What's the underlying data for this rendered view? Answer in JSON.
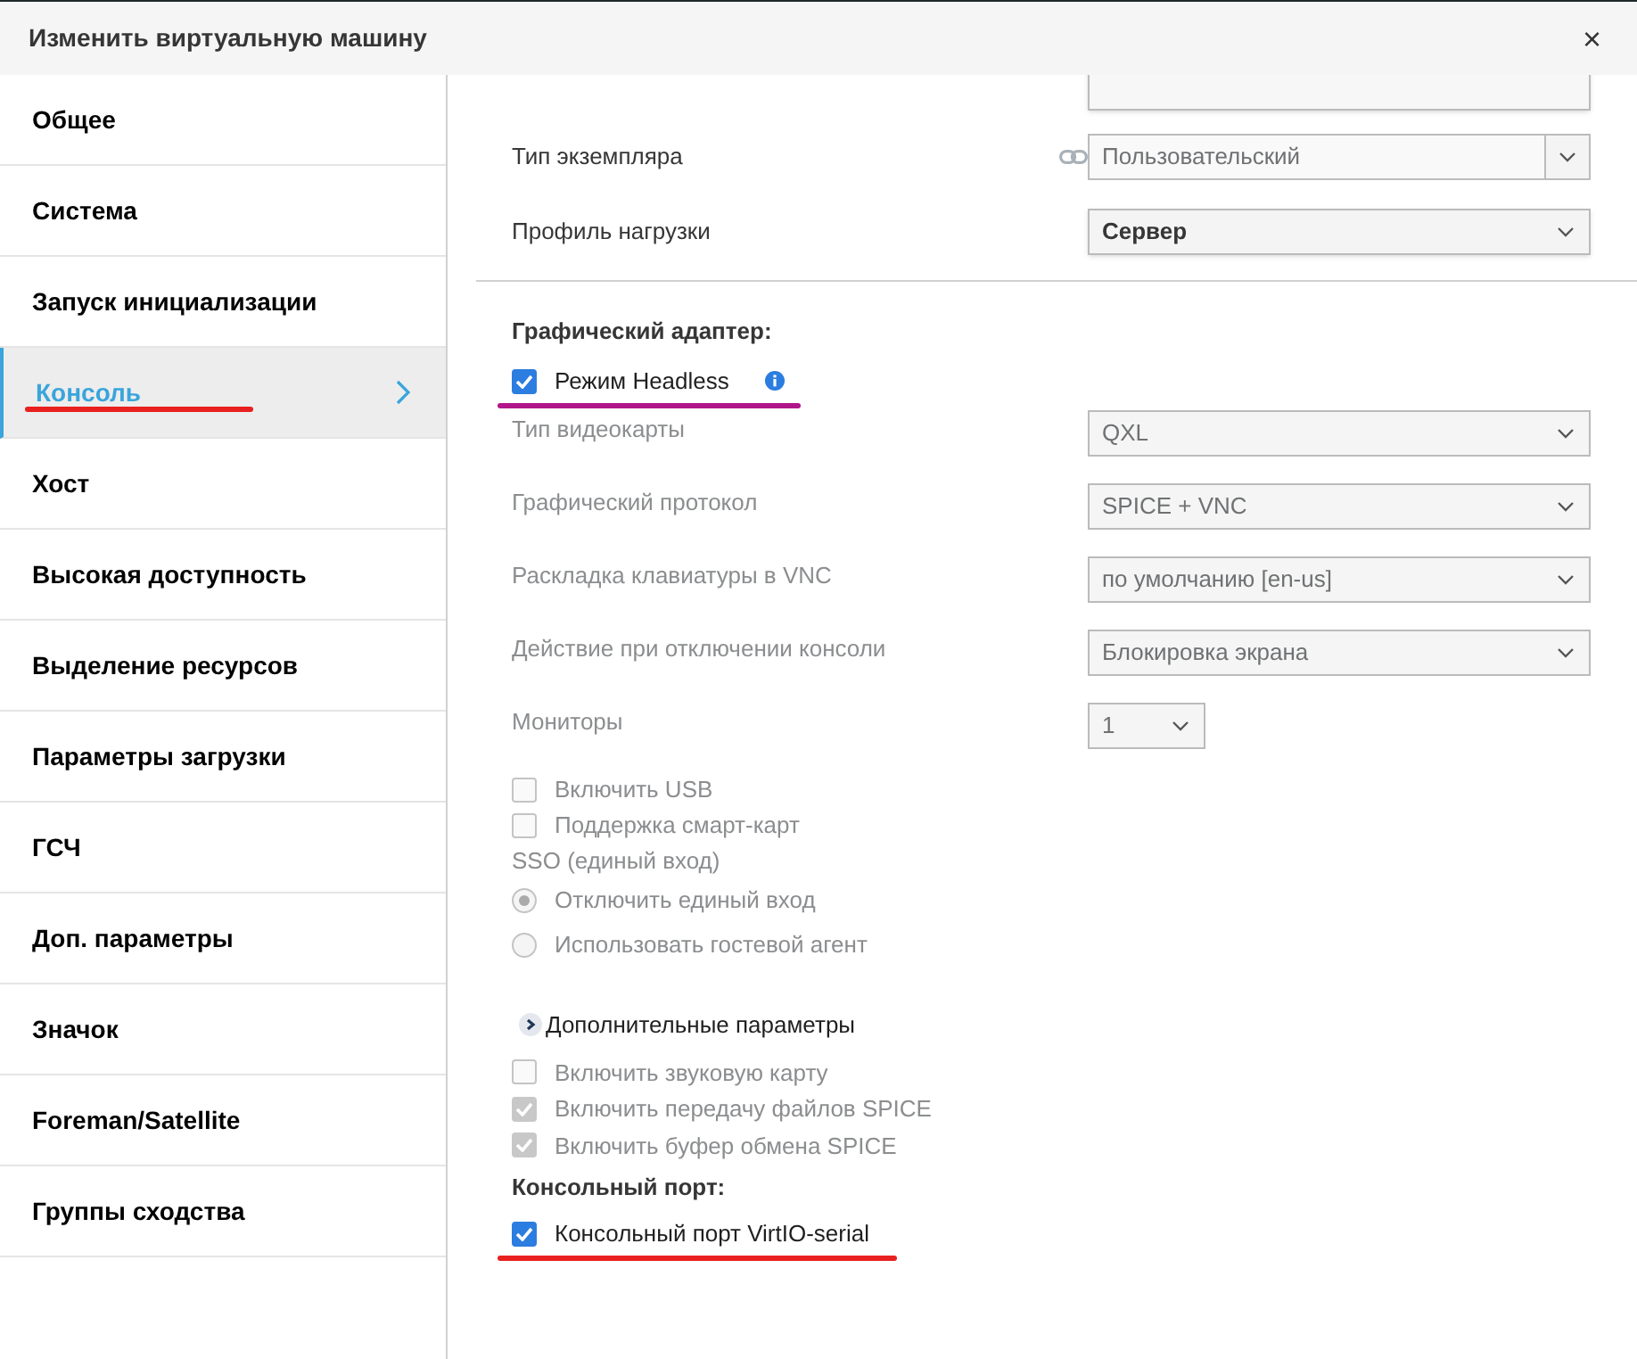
{
  "window": {
    "title": "Изменить виртуальную машину",
    "close": "×"
  },
  "sidebar": {
    "items": [
      {
        "label": "Общее",
        "selected": false
      },
      {
        "label": "Система",
        "selected": false
      },
      {
        "label": "Запуск инициализации",
        "selected": false
      },
      {
        "label": "Консоль",
        "selected": true,
        "underline": {
          "color": "#e8201f"
        }
      },
      {
        "label": "Хост",
        "selected": false
      },
      {
        "label": "Высокая доступность",
        "selected": false
      },
      {
        "label": "Выделение ресурсов",
        "selected": false
      },
      {
        "label": "Параметры загрузки",
        "selected": false
      },
      {
        "label": "ГСЧ",
        "selected": false
      },
      {
        "label": "Доп. параметры",
        "selected": false
      },
      {
        "label": "Значок",
        "selected": false
      },
      {
        "label": "Foreman/Satellite",
        "selected": false
      },
      {
        "label": "Группы сходства",
        "selected": false
      }
    ]
  },
  "general_fields": [
    {
      "kind": "linked",
      "label": "Тип экземпляра",
      "value": "Пользовательский",
      "disabled": true
    },
    {
      "kind": "plain",
      "label": "Профиль нагрузки",
      "value": "Сервер",
      "disabled": false
    }
  ],
  "graphics": {
    "heading": "Графический адаптер:",
    "headless": {
      "label": "Режим Headless",
      "checked": true,
      "underline": {
        "color": "#b0168a"
      }
    },
    "fields": [
      {
        "label": "Тип видеокарты",
        "value": "QXL",
        "disabled": true,
        "narrow": false
      },
      {
        "label": "Графический протокол",
        "value": "SPICE + VNC",
        "disabled": true,
        "narrow": false
      },
      {
        "label": "Раскладка клавиатуры в VNC",
        "value": "по умолчанию [en-us]",
        "disabled": true,
        "narrow": false
      },
      {
        "label": "Действие при отключении консоли",
        "value": "Блокировка экрана",
        "disabled": true,
        "narrow": false
      },
      {
        "label": "Мониторы",
        "value": "1",
        "disabled": true,
        "narrow": true
      }
    ],
    "options": [
      {
        "kind": "checkbox",
        "label": "Включить USB",
        "checked": false,
        "disabled": true
      },
      {
        "kind": "checkbox",
        "label": "Поддержка смарт-карт",
        "checked": false,
        "disabled": true
      },
      {
        "kind": "caption",
        "label": "SSO (единый вход)"
      },
      {
        "kind": "radio",
        "label": "Отключить единый вход",
        "selected": true,
        "disabled": true
      },
      {
        "kind": "radio",
        "label": "Использовать гостевой агент",
        "selected": false,
        "disabled": true
      }
    ],
    "advanced": {
      "label": "Дополнительные параметры",
      "expanded": false
    },
    "advanced_options": [
      {
        "label": "Включить звуковую карту",
        "checked": false,
        "disabled": true
      },
      {
        "label": "Включить передачу файлов SPICE",
        "checked": true,
        "disabled": true
      },
      {
        "label": "Включить буфер обмена SPICE",
        "checked": true,
        "disabled": true
      }
    ]
  },
  "console_port": {
    "heading": "Консольный порт:",
    "option": {
      "label": "Консольный порт VirtIO-serial",
      "checked": true,
      "disabled": false,
      "underline": {
        "color": "#e8201f"
      }
    }
  }
}
